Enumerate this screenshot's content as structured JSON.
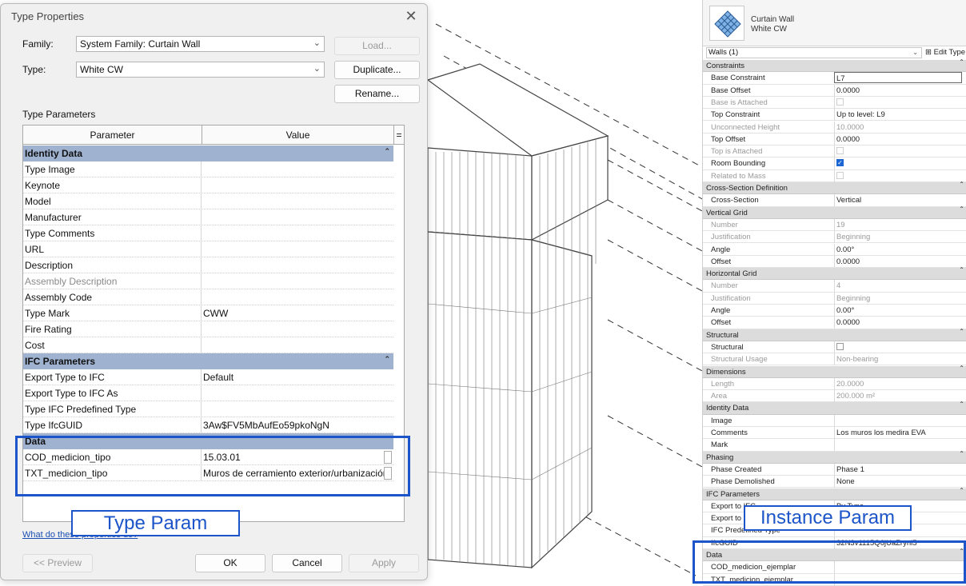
{
  "dialog": {
    "title": "Type Properties",
    "family_label": "Family:",
    "family_value": "System Family: Curtain Wall",
    "type_label": "Type:",
    "type_value": "White CW",
    "load_button": "Load...",
    "duplicate_button": "Duplicate...",
    "rename_button": "Rename...",
    "type_parameters_label": "Type Parameters",
    "col_parameter": "Parameter",
    "col_value": "Value",
    "col_eq": "=",
    "groups": [
      {
        "name": "Identity Data",
        "rows": [
          {
            "param": "Type Image",
            "value": ""
          },
          {
            "param": "Keynote",
            "value": ""
          },
          {
            "param": "Model",
            "value": ""
          },
          {
            "param": "Manufacturer",
            "value": ""
          },
          {
            "param": "Type Comments",
            "value": ""
          },
          {
            "param": "URL",
            "value": ""
          },
          {
            "param": "Description",
            "value": ""
          },
          {
            "param": "Assembly Description",
            "value": ""
          },
          {
            "param": "Assembly Code",
            "value": ""
          },
          {
            "param": "Type Mark",
            "value": "CWW"
          },
          {
            "param": "Fire Rating",
            "value": ""
          },
          {
            "param": "Cost",
            "value": ""
          }
        ]
      },
      {
        "name": "IFC Parameters",
        "rows": [
          {
            "param": "Export Type to IFC",
            "value": "Default"
          },
          {
            "param": "Export Type to IFC As",
            "value": ""
          },
          {
            "param": "Type IFC Predefined Type",
            "value": ""
          },
          {
            "param": "Type IfcGUID",
            "value": "3Aw$FV5MbAufEo59pkoNgN"
          }
        ]
      },
      {
        "name": "Data",
        "rows": [
          {
            "param": "COD_medicion_tipo",
            "value": "15.03.01"
          },
          {
            "param": "TXT_medicion_tipo",
            "value": "Muros de cerramiento exterior/urbanización"
          }
        ]
      }
    ],
    "help_link": "What do these properties do?",
    "preview_button": "<< Preview",
    "ok_button": "OK",
    "cancel_button": "Cancel",
    "apply_button": "Apply"
  },
  "annotations": {
    "type_param": "Type Param",
    "instance_param": "Instance Param"
  },
  "palette": {
    "type_name_line1": "Curtain Wall",
    "type_name_line2": "White CW",
    "selector": "Walls (1)",
    "edit_type": "Edit Type",
    "rows": [
      {
        "kind": "section",
        "k": "Constraints"
      },
      {
        "k": "Base Constraint",
        "v": "L7",
        "field": true
      },
      {
        "k": "Base Offset",
        "v": "0.0000"
      },
      {
        "k": "Base is Attached",
        "check": "dim",
        "grey": true
      },
      {
        "k": "Top Constraint",
        "v": "Up to level: L9"
      },
      {
        "k": "Unconnected Height",
        "v": "10.0000",
        "grey": true
      },
      {
        "k": "Top Offset",
        "v": "0.0000"
      },
      {
        "k": "Top is Attached",
        "check": "dim",
        "grey": true
      },
      {
        "k": "Room Bounding",
        "check": "on"
      },
      {
        "k": "Related to Mass",
        "check": "dim",
        "grey": true
      },
      {
        "kind": "section",
        "k": "Cross-Section Definition"
      },
      {
        "k": "Cross-Section",
        "v": "Vertical"
      },
      {
        "kind": "section",
        "k": "Vertical Grid"
      },
      {
        "k": "Number",
        "v": "19",
        "grey": true
      },
      {
        "k": "Justification",
        "v": "Beginning",
        "grey": true
      },
      {
        "k": "Angle",
        "v": "0.00°"
      },
      {
        "k": "Offset",
        "v": "0.0000"
      },
      {
        "kind": "section",
        "k": "Horizontal Grid"
      },
      {
        "k": "Number",
        "v": "4",
        "grey": true
      },
      {
        "k": "Justification",
        "v": "Beginning",
        "grey": true
      },
      {
        "k": "Angle",
        "v": "0.00°"
      },
      {
        "k": "Offset",
        "v": "0.0000"
      },
      {
        "kind": "section",
        "k": "Structural"
      },
      {
        "k": "Structural",
        "check": "off"
      },
      {
        "k": "Structural Usage",
        "v": "Non-bearing",
        "grey": true
      },
      {
        "kind": "section",
        "k": "Dimensions"
      },
      {
        "k": "Length",
        "v": "20.0000",
        "grey": true
      },
      {
        "k": "Area",
        "v": "200.000 m²",
        "grey": true
      },
      {
        "kind": "section",
        "k": "Identity Data"
      },
      {
        "k": "Image",
        "v": ""
      },
      {
        "k": "Comments",
        "v": "Los muros los medira EVA"
      },
      {
        "k": "Mark",
        "v": ""
      },
      {
        "kind": "section",
        "k": "Phasing"
      },
      {
        "k": "Phase Created",
        "v": "Phase 1"
      },
      {
        "k": "Phase Demolished",
        "v": "None"
      },
      {
        "kind": "section",
        "k": "IFC Parameters"
      },
      {
        "k": "Export to IFC",
        "v": "By Type"
      },
      {
        "k": "Export to IFC As",
        "v": ""
      },
      {
        "k": "IFC Predefined Type",
        "v": ""
      },
      {
        "k": "IfcGUID",
        "v": "32N3v1115Q6jUaZrynl5"
      },
      {
        "kind": "section",
        "k": "Data"
      },
      {
        "k": "COD_medicion_ejemplar",
        "v": ""
      },
      {
        "k": "TXT_medicion_ejemplar",
        "v": ""
      }
    ]
  },
  "colors": {
    "accent": "#1c55c9",
    "group_header": "#9fb3d1",
    "section_header": "#dcdcdc"
  }
}
